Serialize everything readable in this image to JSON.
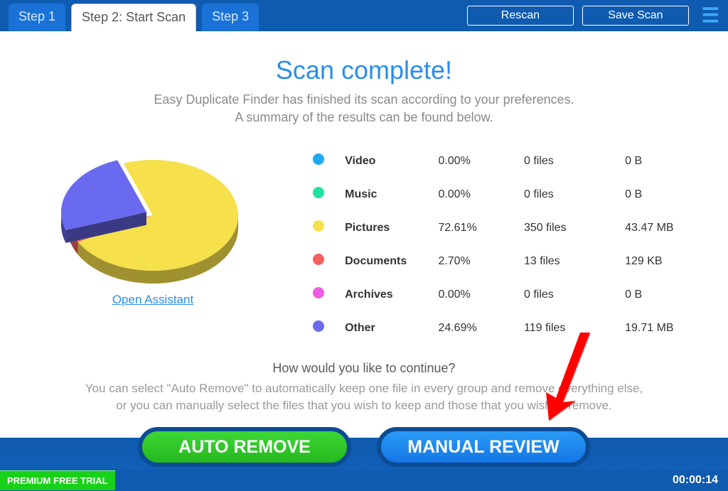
{
  "tabs": {
    "step1": "Step 1",
    "step2": "Step 2: Start Scan",
    "step3": "Step 3"
  },
  "buttons": {
    "rescan": "Rescan",
    "save_scan": "Save Scan",
    "auto_remove": "AUTO REMOVE",
    "manual_review": "MANUAL REVIEW"
  },
  "title": "Scan complete!",
  "subtitle_line1": "Easy Duplicate Finder has finished its scan according to your preferences.",
  "subtitle_line2": "A summary of the results can be found below.",
  "open_assistant": "Open Assistant",
  "legend": [
    {
      "label": "Video",
      "pct": "0.00%",
      "files": "0 files",
      "size": "0 B",
      "color": "#20a8f4"
    },
    {
      "label": "Music",
      "pct": "0.00%",
      "files": "0 files",
      "size": "0 B",
      "color": "#1ee29f"
    },
    {
      "label": "Pictures",
      "pct": "72.61%",
      "files": "350 files",
      "size": "43.47 MB",
      "color": "#f6e04b"
    },
    {
      "label": "Documents",
      "pct": "2.70%",
      "files": "13 files",
      "size": "129 KB",
      "color": "#f55f5f"
    },
    {
      "label": "Archives",
      "pct": "0.00%",
      "files": "0 files",
      "size": "0 B",
      "color": "#f05be3"
    },
    {
      "label": "Other",
      "pct": "24.69%",
      "files": "119 files",
      "size": "19.71 MB",
      "color": "#6a6af0"
    }
  ],
  "question": "How would you like to continue?",
  "help_line1": "You can select \"Auto Remove\" to automatically keep one file in every group and remove everything else,",
  "help_line2": "or you can manually select the files that you wish to keep and those that you wish to remove.",
  "footer": {
    "badge": "PREMIUM FREE TRIAL",
    "timer": "00:00:14"
  },
  "chart_data": {
    "type": "pie",
    "title": "Scan results by category",
    "series": [
      {
        "name": "Video",
        "value": 0.0
      },
      {
        "name": "Music",
        "value": 0.0
      },
      {
        "name": "Pictures",
        "value": 72.61
      },
      {
        "name": "Documents",
        "value": 2.7
      },
      {
        "name": "Archives",
        "value": 0.0
      },
      {
        "name": "Other",
        "value": 24.69
      }
    ],
    "unit": "percent"
  }
}
